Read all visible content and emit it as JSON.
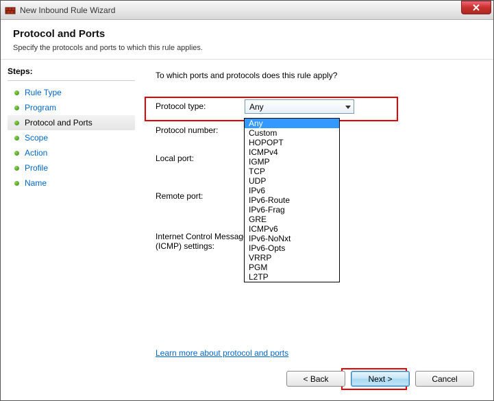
{
  "window": {
    "title": "New Inbound Rule Wizard"
  },
  "header": {
    "title": "Protocol and Ports",
    "subtitle": "Specify the protocols and ports to which this rule applies."
  },
  "sidebar": {
    "heading": "Steps:",
    "items": [
      {
        "label": "Rule Type",
        "current": false
      },
      {
        "label": "Program",
        "current": false
      },
      {
        "label": "Protocol and Ports",
        "current": true
      },
      {
        "label": "Scope",
        "current": false
      },
      {
        "label": "Action",
        "current": false
      },
      {
        "label": "Profile",
        "current": false
      },
      {
        "label": "Name",
        "current": false
      }
    ]
  },
  "content": {
    "prompt": "To which ports and protocols does this rule apply?",
    "labels": {
      "protocol_type": "Protocol type:",
      "protocol_number": "Protocol number:",
      "local_port": "Local port:",
      "remote_port": "Remote port:",
      "icmp_line1": "Internet Control Message Protocol",
      "icmp_line2": "(ICMP) settings:"
    },
    "combo": {
      "selected": "Any",
      "options": [
        "Any",
        "Custom",
        "HOPOPT",
        "ICMPv4",
        "IGMP",
        "TCP",
        "UDP",
        "IPv6",
        "IPv6-Route",
        "IPv6-Frag",
        "GRE",
        "ICMPv6",
        "IPv6-NoNxt",
        "IPv6-Opts",
        "VRRP",
        "PGM",
        "L2TP"
      ]
    },
    "learn_more": "Learn more about protocol and ports"
  },
  "footer": {
    "back": "< Back",
    "next": "Next >",
    "cancel": "Cancel"
  }
}
